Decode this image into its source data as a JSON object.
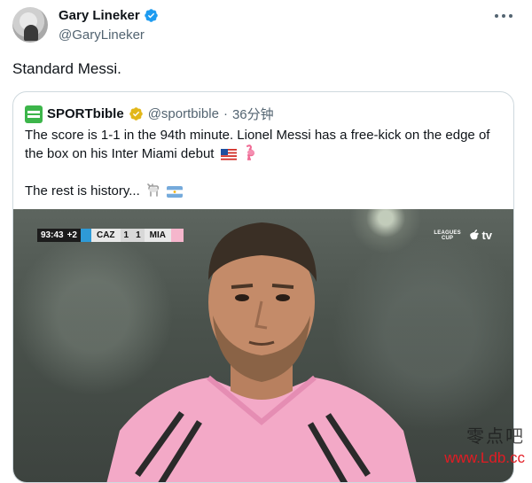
{
  "tweet": {
    "author_name": "Gary Lineker",
    "author_handle": "@GaryLineker",
    "text": "Standard Messi."
  },
  "quoted_tweet": {
    "author_name": "SPORTbible",
    "author_handle": "@sportbible",
    "separator": "·",
    "time": "36分钟",
    "text_line1": "The score is 1-1 in the 94th minute. Lionel Messi has a free-kick on the edge of the box on his Inter Miami debut",
    "text_line2": "The rest is history...",
    "media": {
      "scoreboard": {
        "clock": "93:43",
        "added_time": "+2",
        "home_team": "CAZ",
        "home_score": "1",
        "away_score": "1",
        "away_team": "MIA"
      },
      "broadcast_logo": "LEAGUES CUP",
      "broadcaster": "tv"
    }
  },
  "watermark": {
    "chinese": "零点吧",
    "url": "www.Ldb.cc"
  },
  "colors": {
    "verified_blue": "#1d9bf0",
    "verified_gold": "#e2b719",
    "brand_green": "#3cb54a",
    "home_team_color": "#2e9ad7",
    "away_team_color": "#f5b6cc"
  },
  "icons": [
    "verified-badge-icon",
    "more-options-icon",
    "us-flag-icon",
    "flamingo-icon",
    "goat-icon",
    "argentina-flag-icon",
    "apple-icon"
  ]
}
